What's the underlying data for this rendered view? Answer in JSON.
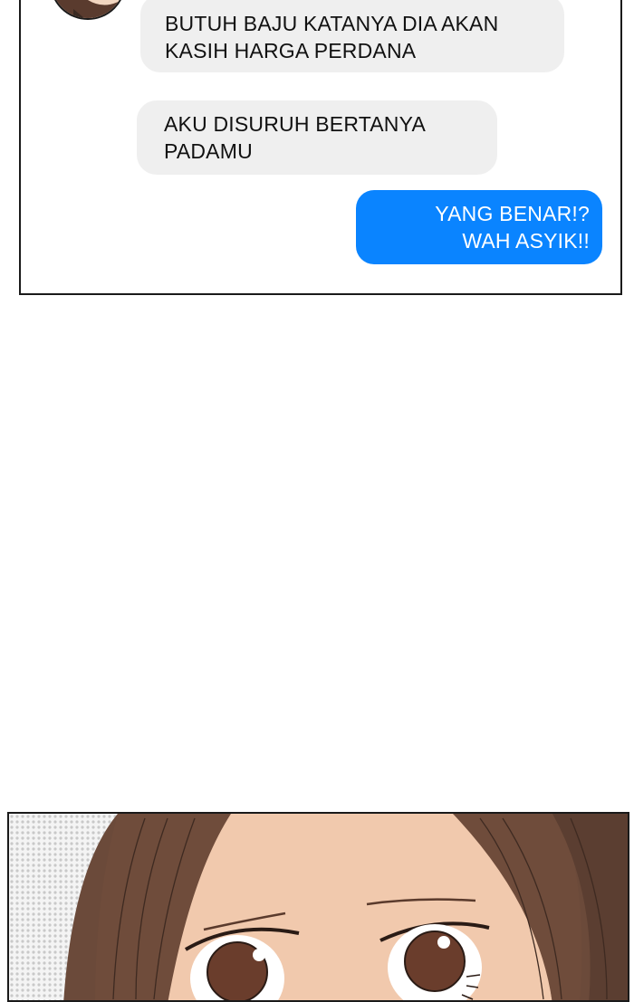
{
  "chat": {
    "messages": [
      {
        "side": "left",
        "lines": [
          "BUTUH BAJU KATANYA DIA AKAN",
          "KASIH HARGA PERDANA"
        ]
      },
      {
        "side": "left",
        "lines": [
          "AKU DISURUH BERTANYA",
          "PADAMU"
        ]
      },
      {
        "side": "right",
        "lines": [
          "YANG BENAR!?",
          "WAH ASYIK!!"
        ]
      }
    ]
  },
  "colors": {
    "bubble_gray": "#efefef",
    "bubble_blue": "#0a84ff",
    "hair": "#6b4a3a",
    "skin": "#f1c9ad",
    "iris": "#6a3d2c"
  },
  "icons": {
    "avatar": "contact-avatar-icon"
  }
}
